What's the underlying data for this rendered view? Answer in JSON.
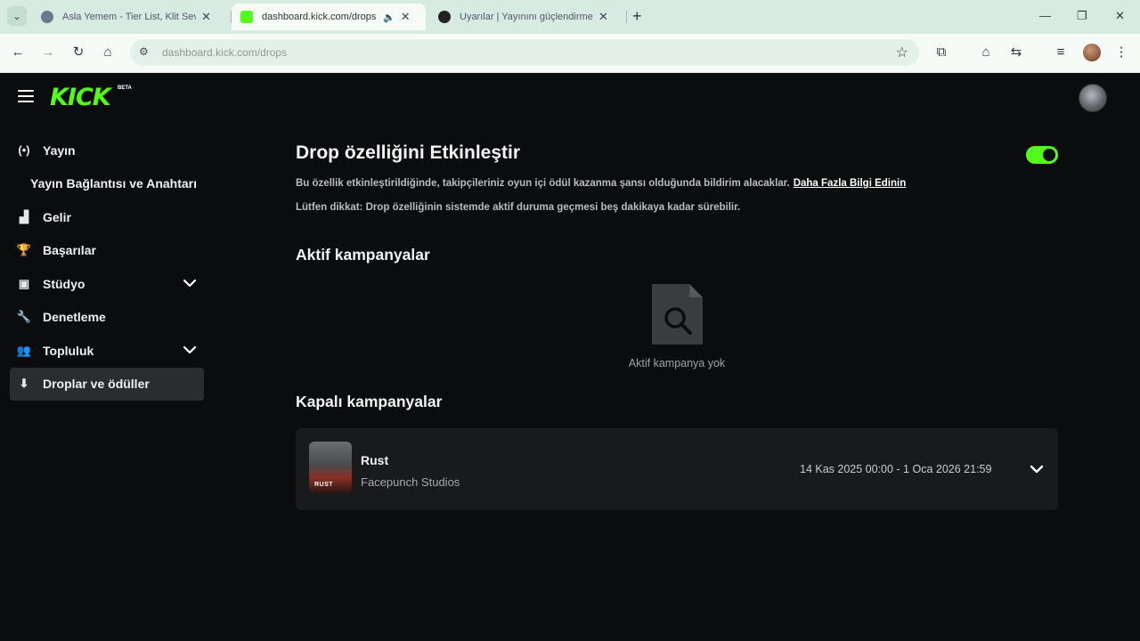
{
  "browser": {
    "tabs": [
      {
        "title": "Asla Yemem - Tier List, Klit Sev...",
        "favicon_color": "#6b7a8a"
      },
      {
        "title": "dashboard.kick.com/drops",
        "favicon_color": "#53fc18",
        "active": true
      },
      {
        "title": "Uyarılar | Yayınını güçlendirme...",
        "favicon_color": "#222222"
      }
    ],
    "url": "dashboard.kick.com/drops"
  },
  "app": {
    "logo": "KICK",
    "logo_badge": "BETA"
  },
  "sidebar": {
    "items": [
      {
        "label": "Yayın",
        "icon": "broadcast-icon",
        "glyph": "(•)"
      },
      {
        "label": "Yayın Bağlantısı ve Anahtarı",
        "icon": "",
        "glyph": ""
      },
      {
        "label": "Gelir",
        "icon": "revenue-chart-icon",
        "glyph": "▟"
      },
      {
        "label": "Başarılar",
        "icon": "trophy-icon",
        "glyph": "🏆"
      },
      {
        "label": "Stüdyo",
        "icon": "studio-icon",
        "glyph": "▣"
      },
      {
        "label": "Denetleme",
        "icon": "wrench-icon",
        "glyph": "🔧"
      },
      {
        "label": "Topluluk",
        "icon": "community-icon",
        "glyph": "👥"
      },
      {
        "label": "Droplar ve ödüller",
        "icon": "drops-icon",
        "glyph": "⬇"
      }
    ]
  },
  "main": {
    "title": "Drop özelliğini Etkinleştir",
    "toggle_on": true,
    "description": "Bu özellik etkinleştirildiğinde, takipçileriniz oyun içi ödül kazanma şansı olduğunda bildirim alacaklar.",
    "learn_more": "Daha Fazla Bilgi Edinin",
    "note": "Lütfen dikkat: Drop özelliğinin sistemde aktif duruma geçmesi beş dakikaya kadar sürebilir.",
    "active_heading": "Aktif kampanyalar",
    "active_empty": "Aktif kampanya yok",
    "closed_heading": "Kapalı kampanyalar",
    "closed_campaigns": [
      {
        "name": "Rust",
        "developer": "Facepunch Studios",
        "dates": "14 Kas 2025 00:00 - 1 Oca 2026 21:59",
        "thumb_label": "RUST"
      }
    ]
  },
  "colors": {
    "accent": "#53fc18",
    "background": "#0b0c0d",
    "card": "#191a1c"
  }
}
